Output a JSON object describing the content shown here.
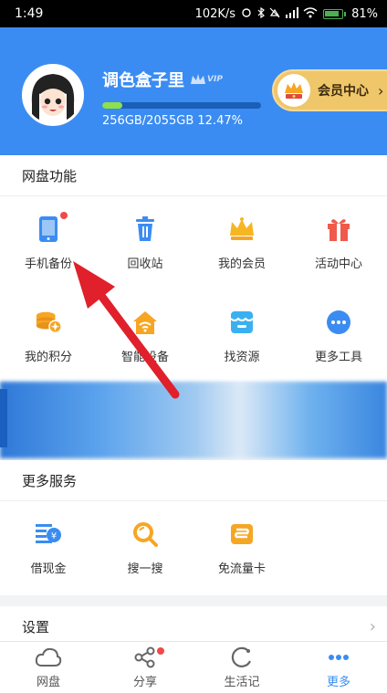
{
  "status_bar": {
    "time": "1:49",
    "speed": "102K/s",
    "battery": "81%"
  },
  "profile": {
    "username": "调色盒子里",
    "vip_label": "VIP",
    "storage_text": "256GB/2055GB 12.47%",
    "storage_fraction": 0.1247,
    "member_center_label": "会员中心"
  },
  "netdisk": {
    "title": "网盘功能",
    "items": [
      {
        "label": "手机备份",
        "icon": "phone-icon"
      },
      {
        "label": "回收站",
        "icon": "trash-icon"
      },
      {
        "label": "我的会员",
        "icon": "crown-icon"
      },
      {
        "label": "活动中心",
        "icon": "gift-icon"
      },
      {
        "label": "我的积分",
        "icon": "coins-icon"
      },
      {
        "label": "智能设备",
        "icon": "smart-home-icon"
      },
      {
        "label": "找资源",
        "icon": "store-icon"
      },
      {
        "label": "更多工具",
        "icon": "more-dots-icon"
      }
    ]
  },
  "services": {
    "title": "更多服务",
    "items": [
      {
        "label": "借现金",
        "icon": "cash-icon"
      },
      {
        "label": "搜一搜",
        "icon": "magnifier-icon"
      },
      {
        "label": "免流量卡",
        "icon": "sim-card-icon"
      }
    ]
  },
  "settings": {
    "label": "设置"
  },
  "bottom_nav": [
    {
      "label": "网盘",
      "icon": "cloud-icon"
    },
    {
      "label": "分享",
      "icon": "share-icon"
    },
    {
      "label": "生活记",
      "icon": "life-icon"
    },
    {
      "label": "更多",
      "icon": "more-icon"
    }
  ],
  "colors": {
    "brand_blue": "#3b8cf2",
    "gold": "#f0c66a",
    "orange": "#f6a623",
    "red": "#ef4a4a",
    "arrow_red": "#e0202a"
  }
}
